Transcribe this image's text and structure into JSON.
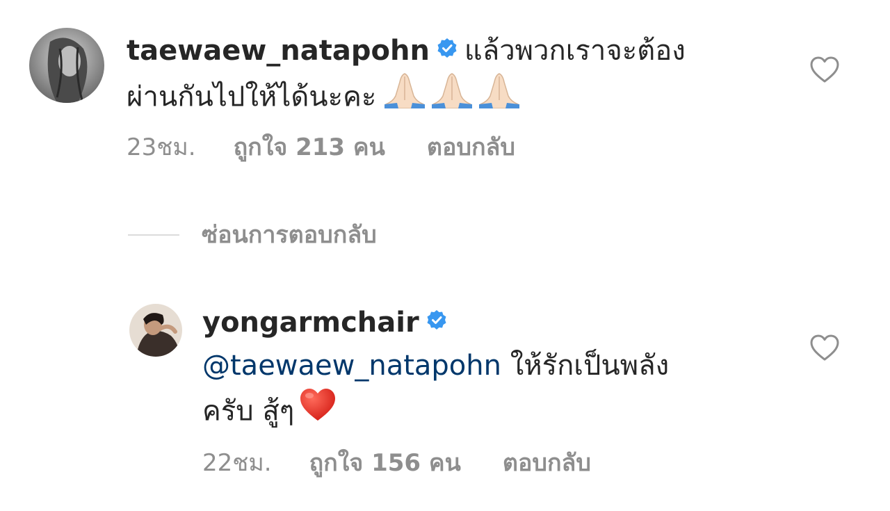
{
  "comments": [
    {
      "username": "taewaew_natapohn",
      "verified": true,
      "text_line1": "แล้วพวกเราจะต้อง",
      "text_line2": "ผ่านกันไปให้ได้นะคะ",
      "emoji": [
        "folded-hands",
        "folded-hands",
        "folded-hands"
      ],
      "time": "23ชม.",
      "likes": "ถูกใจ 213 คน",
      "reply": "ตอบกลับ"
    },
    {
      "username": "yongarmchair",
      "verified": true,
      "mention": "@taewaew_natapohn",
      "text_line1": "ให้รักเป็นพลัง",
      "text_line2": "ครับ สู้ๆ",
      "emoji": [
        "red-heart"
      ],
      "time": "22ชม.",
      "likes": "ถูกใจ 156 คน",
      "reply": "ตอบกลับ"
    }
  ],
  "hide_replies": "ซ่อนการตอบกลับ",
  "colors": {
    "text": "#262626",
    "muted": "#8e8e8e",
    "mention": "#00376b",
    "verified": "#3897f0",
    "divider": "#dbdbdb"
  }
}
